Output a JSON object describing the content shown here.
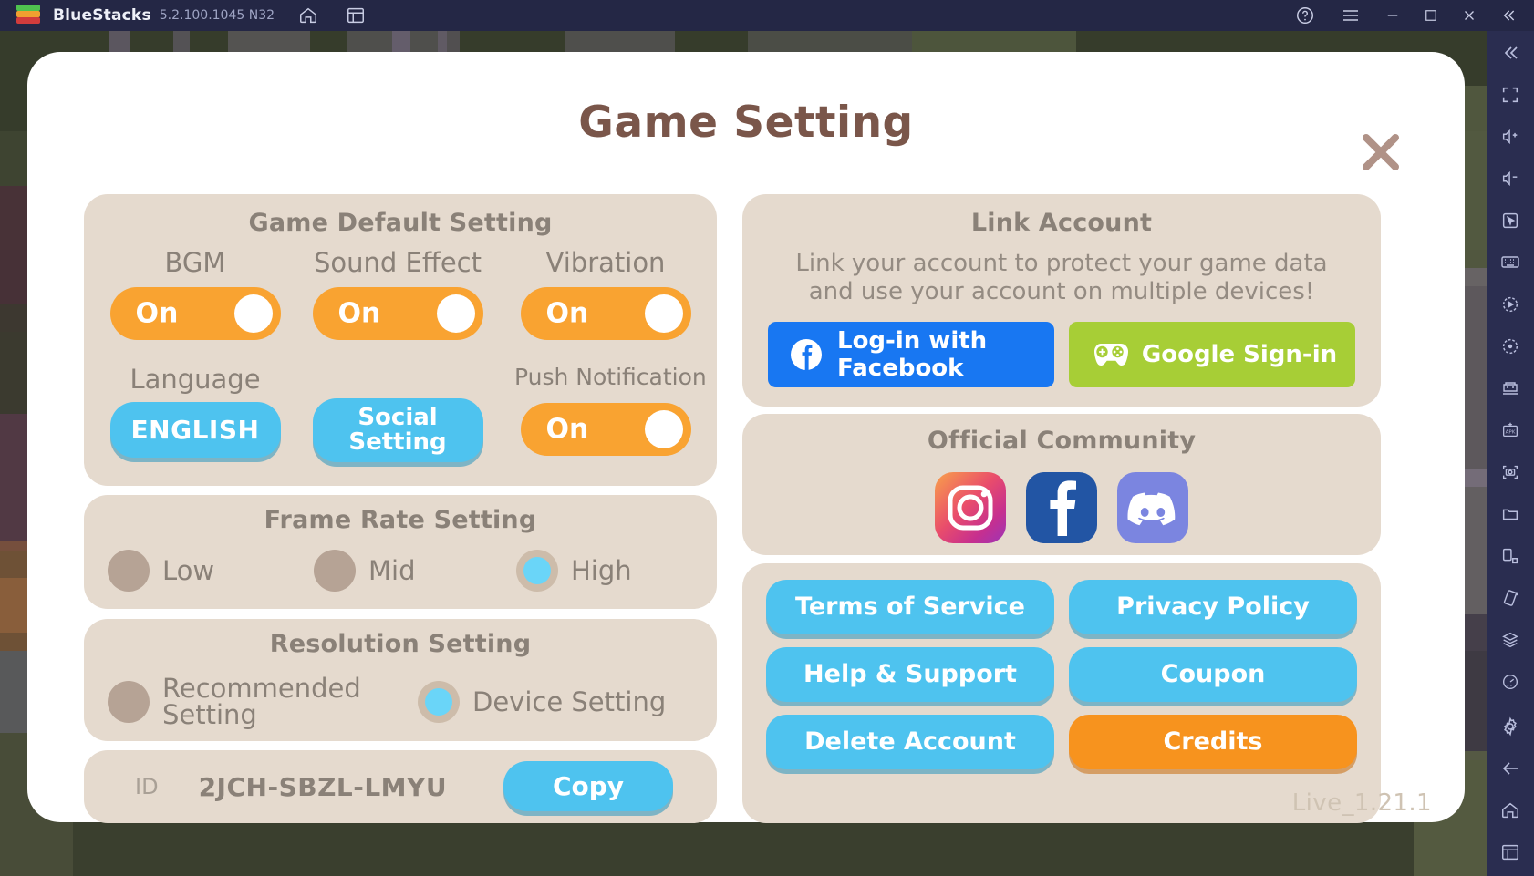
{
  "titlebar": {
    "app_name": "BlueStacks",
    "version": "5.2.100.1045 N32",
    "icons": [
      "bluestacks-logo",
      "home-icon",
      "multi-instance-icon",
      "help-icon",
      "menu-icon",
      "minimize-icon",
      "maximize-icon",
      "close-icon",
      "collapse-icon"
    ]
  },
  "rail": {
    "icons": [
      "collapse-rail-icon",
      "fullscreen-icon",
      "volume-up-icon",
      "volume-down-icon",
      "pointer-icon",
      "keyboard-icon",
      "macro-record-icon",
      "operation-recorder-icon",
      "multi-instance-manager-icon",
      "install-apk-icon",
      "screenshot-icon",
      "media-folder-icon",
      "rotate-screen-icon",
      "shake-icon",
      "layers-icon",
      "eco-mode-icon",
      "settings-icon",
      "back-icon",
      "home-icon",
      "recents-icon"
    ]
  },
  "dialog": {
    "title": "Game Setting",
    "close_label": "close-icon",
    "version_text": "Live_1.21.1"
  },
  "game_default": {
    "title": "Game Default Setting",
    "bgm": {
      "label": "BGM",
      "value": "On"
    },
    "sound_effect": {
      "label": "Sound Effect",
      "value": "On"
    },
    "vibration": {
      "label": "Vibration",
      "value": "On"
    },
    "language": {
      "label": "Language",
      "value": "ENGLISH"
    },
    "social": {
      "line1": "Social",
      "line2": "Setting"
    },
    "push": {
      "label": "Push Notification",
      "value": "On"
    }
  },
  "frame_rate": {
    "title": "Frame Rate Setting",
    "options": [
      {
        "label": "Low",
        "selected": false
      },
      {
        "label": "Mid",
        "selected": false
      },
      {
        "label": "High",
        "selected": true
      }
    ]
  },
  "resolution": {
    "title": "Resolution Setting",
    "options": [
      {
        "label_line1": "Recommended",
        "label_line2": "Setting",
        "selected": false
      },
      {
        "label_line1": "Device Setting",
        "label_line2": "",
        "selected": true
      }
    ]
  },
  "account_id": {
    "key": "ID",
    "value": "2JCH-SBZL-LMYU",
    "copy_label": "Copy"
  },
  "link_account": {
    "title": "Link Account",
    "description_line1": "Link your account to protect your game data",
    "description_line2": "and use your account on multiple devices!",
    "facebook_label": "Log-in with Facebook",
    "google_label": "Google Sign-in"
  },
  "community": {
    "title": "Official Community",
    "items": [
      {
        "name": "instagram-icon"
      },
      {
        "name": "facebook-icon"
      },
      {
        "name": "discord-icon"
      }
    ]
  },
  "link_buttons": [
    {
      "label": "Terms of Service",
      "style": "blue"
    },
    {
      "label": "Privacy Policy",
      "style": "blue"
    },
    {
      "label": "Help & Support",
      "style": "blue"
    },
    {
      "label": "Coupon",
      "style": "blue"
    },
    {
      "label": "Delete Account",
      "style": "blue"
    },
    {
      "label": "Credits",
      "style": "orange"
    }
  ],
  "colors": {
    "panel_bg": "#e5dace",
    "toggle_on": "#f9a331",
    "button_blue": "#4ec3ef",
    "button_orange": "#f7931e",
    "title_brown": "#7a564a",
    "label_gray": "#8a8178",
    "facebook_blue": "#1877f2",
    "google_green": "#a7ce36",
    "discord_purple": "#7b85e0"
  }
}
